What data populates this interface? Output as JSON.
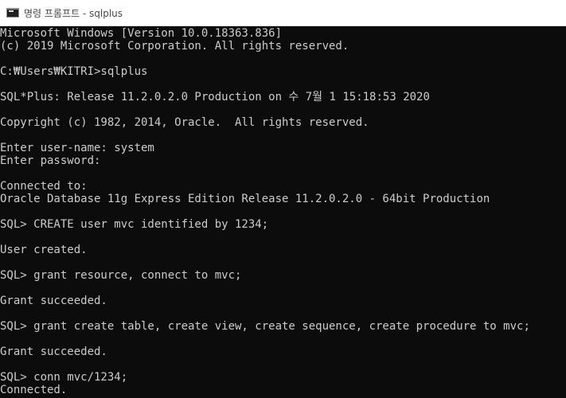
{
  "window": {
    "title": "명령 프롬프트 - sqlplus",
    "icon": "cmd-icon"
  },
  "console": {
    "lines": [
      "Microsoft Windows [Version 10.0.18363.836]",
      "(c) 2019 Microsoft Corporation. All rights reserved.",
      "C:₩Users₩KITRI>sqlplus",
      "SQL*Plus: Release 11.2.0.2.0 Production on 수 7월 1 15:18:53 2020",
      "Copyright (c) 1982, 2014, Oracle.  All rights reserved.",
      "Enter user-name: system",
      "Enter password:",
      "Connected to:",
      "Oracle Database 11g Express Edition Release 11.2.0.2.0 - 64bit Production",
      "SQL> CREATE user mvc identified by 1234;",
      "User created.",
      "SQL> grant resource, connect to mvc;",
      "Grant succeeded.",
      "SQL> grant create table, create view, create sequence, create procedure to mvc;",
      "Grant succeeded.",
      "SQL> conn mvc/1234;",
      "Connected."
    ]
  },
  "colors": {
    "console_bg": "#0c0c0c",
    "console_text": "#cccccc",
    "titlebar_bg": "#ffffff"
  }
}
